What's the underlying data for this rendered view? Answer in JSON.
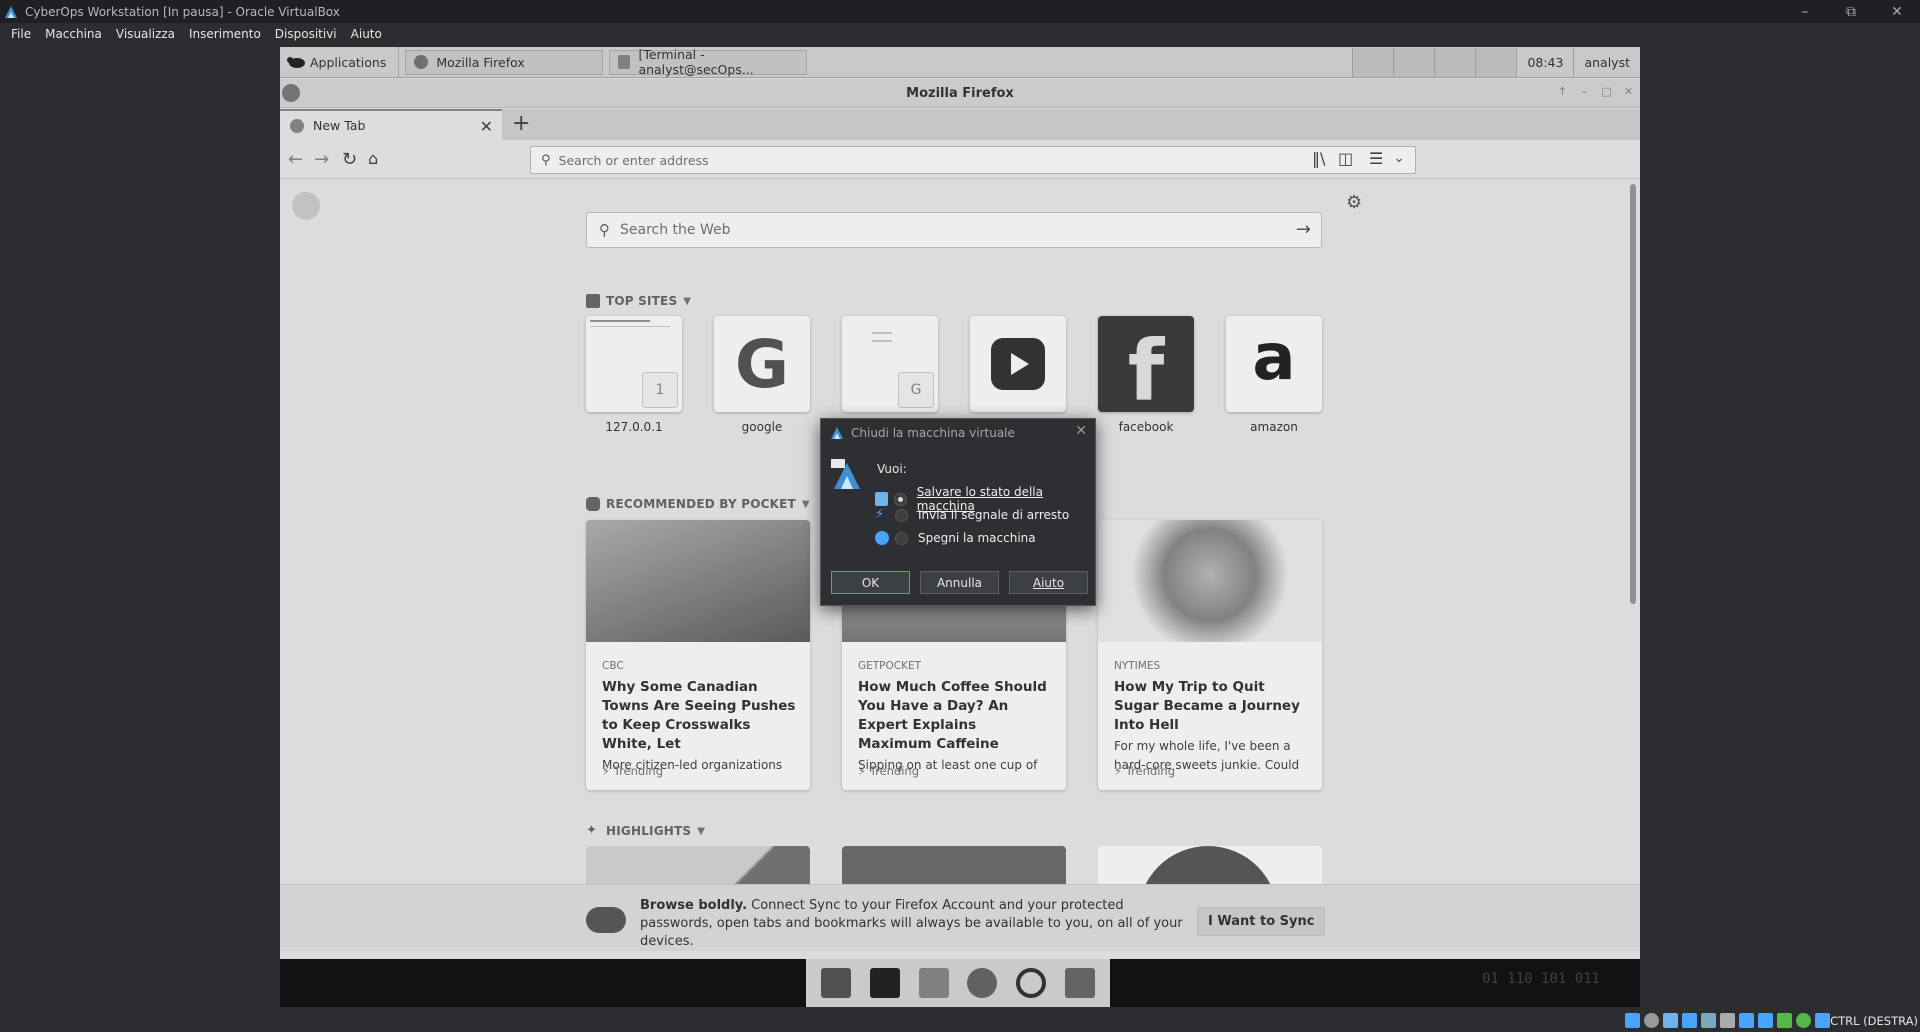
{
  "host": {
    "title": "CyberOps Workstation [In pausa] - Oracle VirtualBox",
    "menu": [
      "File",
      "Macchina",
      "Visualizza",
      "Inserimento",
      "Dispositivi",
      "Aiuto"
    ],
    "host_key": "CTRL (DESTRA)",
    "window_controls": [
      "minimize-icon",
      "restore-icon",
      "close-icon"
    ]
  },
  "guest_panel": {
    "applications": "Applications",
    "tasks": [
      "Mozilla Firefox",
      "[Terminal - analyst@secOps..."
    ],
    "clock": "08:43",
    "user": "analyst"
  },
  "firefox": {
    "window_title": "Mozilla Firefox",
    "tab_title": "New Tab",
    "url_placeholder": "Search or enter address",
    "web_search_placeholder": "Search the Web",
    "top_sites_header": "TOP SITES",
    "top_sites": [
      {
        "label": "127.0.0.1",
        "badge": "1"
      },
      {
        "label": "google",
        "glyph": "G"
      },
      {
        "label": "",
        "badge": "G"
      },
      {
        "label": "",
        "icon": "youtube-play-icon"
      },
      {
        "label": "facebook",
        "glyph": "f"
      },
      {
        "label": "amazon",
        "glyph": "a"
      }
    ],
    "pocket_header": "RECOMMENDED BY POCKET",
    "pocket_cards": [
      {
        "source": "CBC",
        "title": "Why Some Canadian Towns Are Seeing Pushes to Keep Crosswalks White, Let",
        "desc": "More citizen-led organizations",
        "trend": "Trending"
      },
      {
        "source": "GETPOCKET",
        "title": "How Much Coffee Should You Have a Day? An Expert Explains Maximum Caffeine",
        "desc": "Sipping on at least one cup of",
        "trend": "Trending"
      },
      {
        "source": "NYTIMES",
        "title": "How My Trip to Quit Sugar Became a Journey Into Hell",
        "desc": "For my whole life, I've been a hard-core sweets junkie. Could a",
        "trend": "Trending"
      }
    ],
    "highlights_header": "HIGHLIGHTS",
    "sync": {
      "bold": "Browse boldly.",
      "text": " Connect Sync to your Firefox Account and your protected passwords, open tabs and bookmarks will always be available to you, on all of your devices.",
      "button": "I Want to Sync"
    },
    "dock_code": "01 110 101 011"
  },
  "dialog": {
    "title": "Chiudi la macchina virtuale",
    "prompt": "Vuoi:",
    "options": [
      {
        "label": "Salvare lo stato della macchina",
        "selected": true,
        "icon": "save-state-icon"
      },
      {
        "label": "Invia il segnale di arresto",
        "selected": false,
        "icon": "acpi-signal-icon"
      },
      {
        "label": "Spegni la macchina",
        "selected": false,
        "icon": "power-off-icon"
      }
    ],
    "buttons": {
      "ok": "OK",
      "cancel": "Annulla",
      "help": "Aiuto"
    }
  },
  "colors": {
    "host_bg": "#2b2d30",
    "guest_bg": "#ececec",
    "dialog_bg": "#2d2f32",
    "accent_blue": "#4aa3ff"
  }
}
